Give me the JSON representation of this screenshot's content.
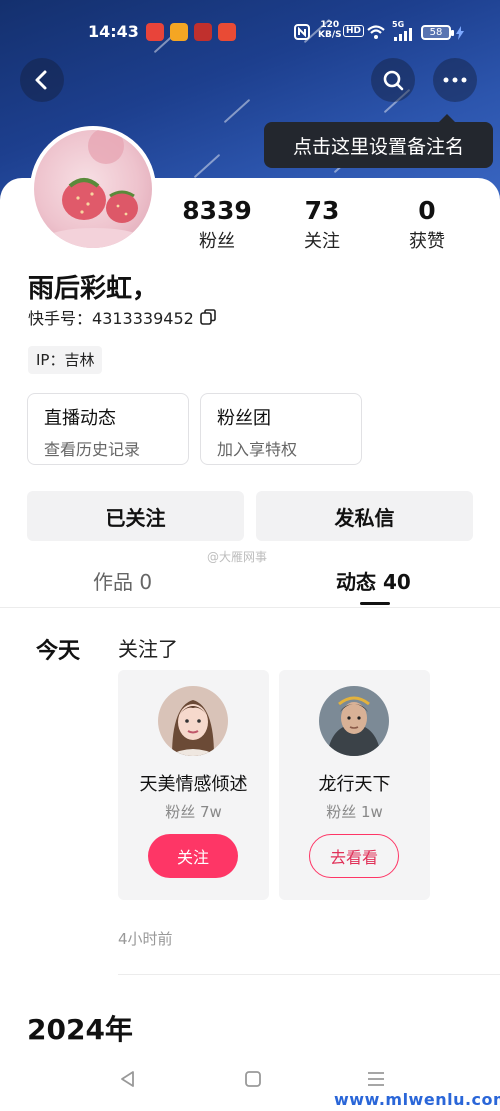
{
  "status_bar": {
    "time": "14:43",
    "network_speed": "120\nKB/S",
    "hd_badge": "HD",
    "signal": "5G",
    "battery": "58",
    "app_icons": [
      "video-app-icon",
      "weibo-icon",
      "game-app-icon",
      "video-play-app-icon"
    ]
  },
  "header": {
    "tooltip": "点击这里设置备注名"
  },
  "profile": {
    "stats": [
      {
        "num": "8339",
        "label": "粉丝"
      },
      {
        "num": "73",
        "label": "关注"
      },
      {
        "num": "0",
        "label": "获赞"
      }
    ],
    "username": "雨后彩虹，",
    "kuaishou_id_label": "快手号：",
    "kuaishou_id": "4313339452",
    "ip_label": "IP：吉林"
  },
  "mini_cards": [
    {
      "title": "直播动态",
      "subtitle": "查看历史记录"
    },
    {
      "title": "粉丝团",
      "subtitle": "加入享特权"
    }
  ],
  "actions": {
    "followed": "已关注",
    "message": "发私信"
  },
  "watermark": "@大雁网事",
  "tabs": {
    "works": "作品 0",
    "dynamics": "动态 40"
  },
  "feed": {
    "day": "今天",
    "action": "关注了",
    "users": [
      {
        "name": "天美情感倾述",
        "fans": "粉丝 7w",
        "button": "关注"
      },
      {
        "name": "龙行天下",
        "fans": "粉丝 1w",
        "button": "去看看"
      }
    ],
    "time_ago": "4小时前",
    "year": "2024年"
  },
  "site_watermark": "www.mlwenlu.com",
  "colors": {
    "accent": "#fe3666",
    "hero": "#1d3f8e",
    "site": "#2a66d8"
  }
}
